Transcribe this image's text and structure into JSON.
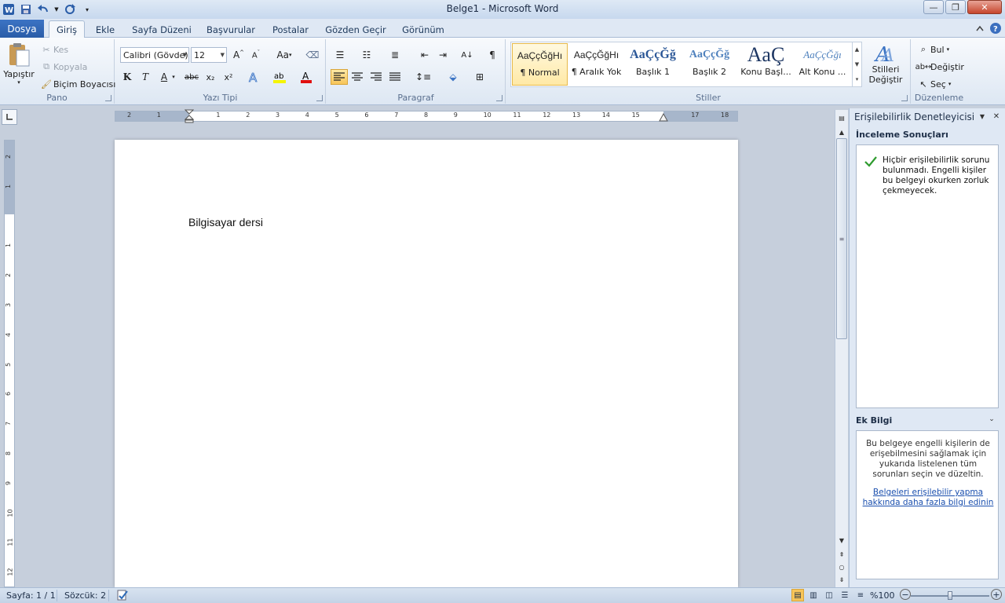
{
  "app": {
    "title": "Belge1 - Microsoft Word"
  },
  "tabs": {
    "file": "Dosya",
    "items": [
      "Giriş",
      "Ekle",
      "Sayfa Düzeni",
      "Başvurular",
      "Postalar",
      "Gözden Geçir",
      "Görünüm"
    ],
    "active": "Giriş"
  },
  "ribbon": {
    "clipboard": {
      "paste": "Yapıştır",
      "cut": "Kes",
      "copy": "Kopyala",
      "format_painter": "Biçim Boyacısı",
      "label": "Pano"
    },
    "font": {
      "name": "Calibri (Gövde)",
      "size": "12",
      "label": "Yazı Tipi",
      "bold": "K",
      "italic": "T",
      "underline": "A",
      "strike": "abc",
      "subscript": "x₂",
      "superscript": "x²",
      "case": "Aa"
    },
    "paragraph": {
      "label": "Paragraf",
      "pilcrow": "¶"
    },
    "styles": {
      "label": "Stiller",
      "items": [
        {
          "sample": "AaÇçĞğHı",
          "name": "¶ Normal"
        },
        {
          "sample": "AaÇçĞğHı",
          "name": "¶ Aralık Yok"
        },
        {
          "sample": "AaÇçĞğ",
          "name": "Başlık 1"
        },
        {
          "sample": "AaÇçĞğ",
          "name": "Başlık 2"
        },
        {
          "sample": "AaÇ",
          "name": "Konu Başl..."
        },
        {
          "sample": "AaÇçĞğı",
          "name": "Alt Konu ..."
        }
      ],
      "change_line1": "Stilleri",
      "change_line2": "Değiştir"
    },
    "editing": {
      "label": "Düzenleme",
      "find": "Bul",
      "replace": "Değiştir",
      "select": "Seç"
    }
  },
  "ruler": {
    "h_numbers": [
      "2",
      "1",
      "1",
      "2",
      "3",
      "4",
      "5",
      "6",
      "7",
      "8",
      "9",
      "10",
      "11",
      "12",
      "13",
      "14",
      "15",
      "17",
      "18"
    ],
    "v_numbers": [
      "2",
      "1",
      "1",
      "2",
      "3",
      "4",
      "5",
      "6",
      "7",
      "8",
      "9",
      "10",
      "11",
      "12"
    ]
  },
  "document": {
    "text": "Bilgisayar dersi"
  },
  "pane": {
    "title": "Erişilebilirlik Denetleyicisi",
    "results_heading": "İnceleme Sonuçları",
    "result_message": "Hiçbir erişilebilirlik sorunu bulunmadı. Engelli kişiler bu belgeyi okurken zorluk çekmeyecek.",
    "more_info_heading": "Ek Bilgi",
    "info_text": "Bu belgeye engelli kişilerin de erişebilmesini sağlamak için yukarıda listelenen tüm sorunları seçin ve düzeltin.",
    "info_link": "Belgeleri erişilebilir yapma hakkında daha fazla bilgi edinin"
  },
  "status": {
    "page": "Sayfa: 1 / 1",
    "words": "Sözcük: 2",
    "zoom": "%100",
    "zoom_percent": 100
  },
  "colors": {
    "accent": "#2a5da8",
    "link": "#1a4fae",
    "check": "#2e9b2e"
  }
}
